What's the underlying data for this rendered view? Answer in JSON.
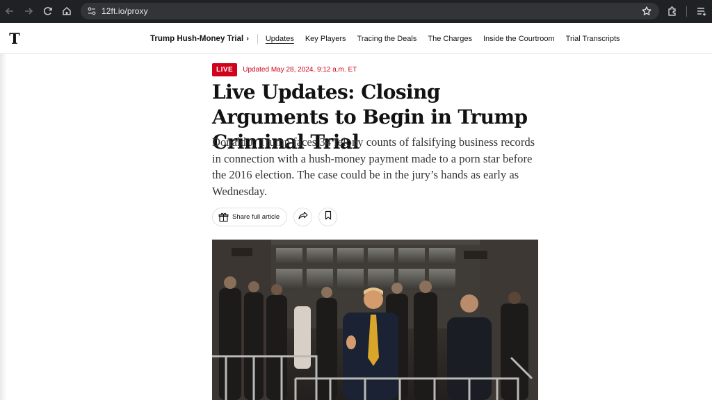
{
  "browser": {
    "url": "12ft.io/proxy",
    "icons": [
      "back-arrow-icon",
      "forward-arrow-icon",
      "reload-icon",
      "home-icon",
      "site-settings-icon",
      "bookmark-star-icon",
      "extensions-icon",
      "reading-list-icon"
    ]
  },
  "nyt": {
    "logo": "T",
    "nav": {
      "title": "Trump Hush-Money Trial",
      "chevron": "›",
      "items": [
        "Updates",
        "Key Players",
        "Tracing the Deals",
        "The Charges",
        "Inside the Courtroom",
        "Trial Transcripts"
      ]
    }
  },
  "article": {
    "live_badge": "LIVE",
    "updated": "Updated May 28, 2024, 9:12 a.m. ET",
    "headline": "Live Updates: Closing Arguments to Begin in Trump Criminal Trial",
    "summary": "Donald J. Trump faces 34 felony counts of falsifying business records in connection with a hush-money payment made to a porn star before the 2016 election. The case could be in the jury’s hands as early as Wednesday.",
    "share_label": "Share full article",
    "icons": [
      "gift-icon",
      "share-arrow-icon",
      "bookmark-icon"
    ]
  },
  "colors": {
    "chrome_bg": "#202124",
    "live_red": "#d0021b",
    "text": "#121212"
  }
}
